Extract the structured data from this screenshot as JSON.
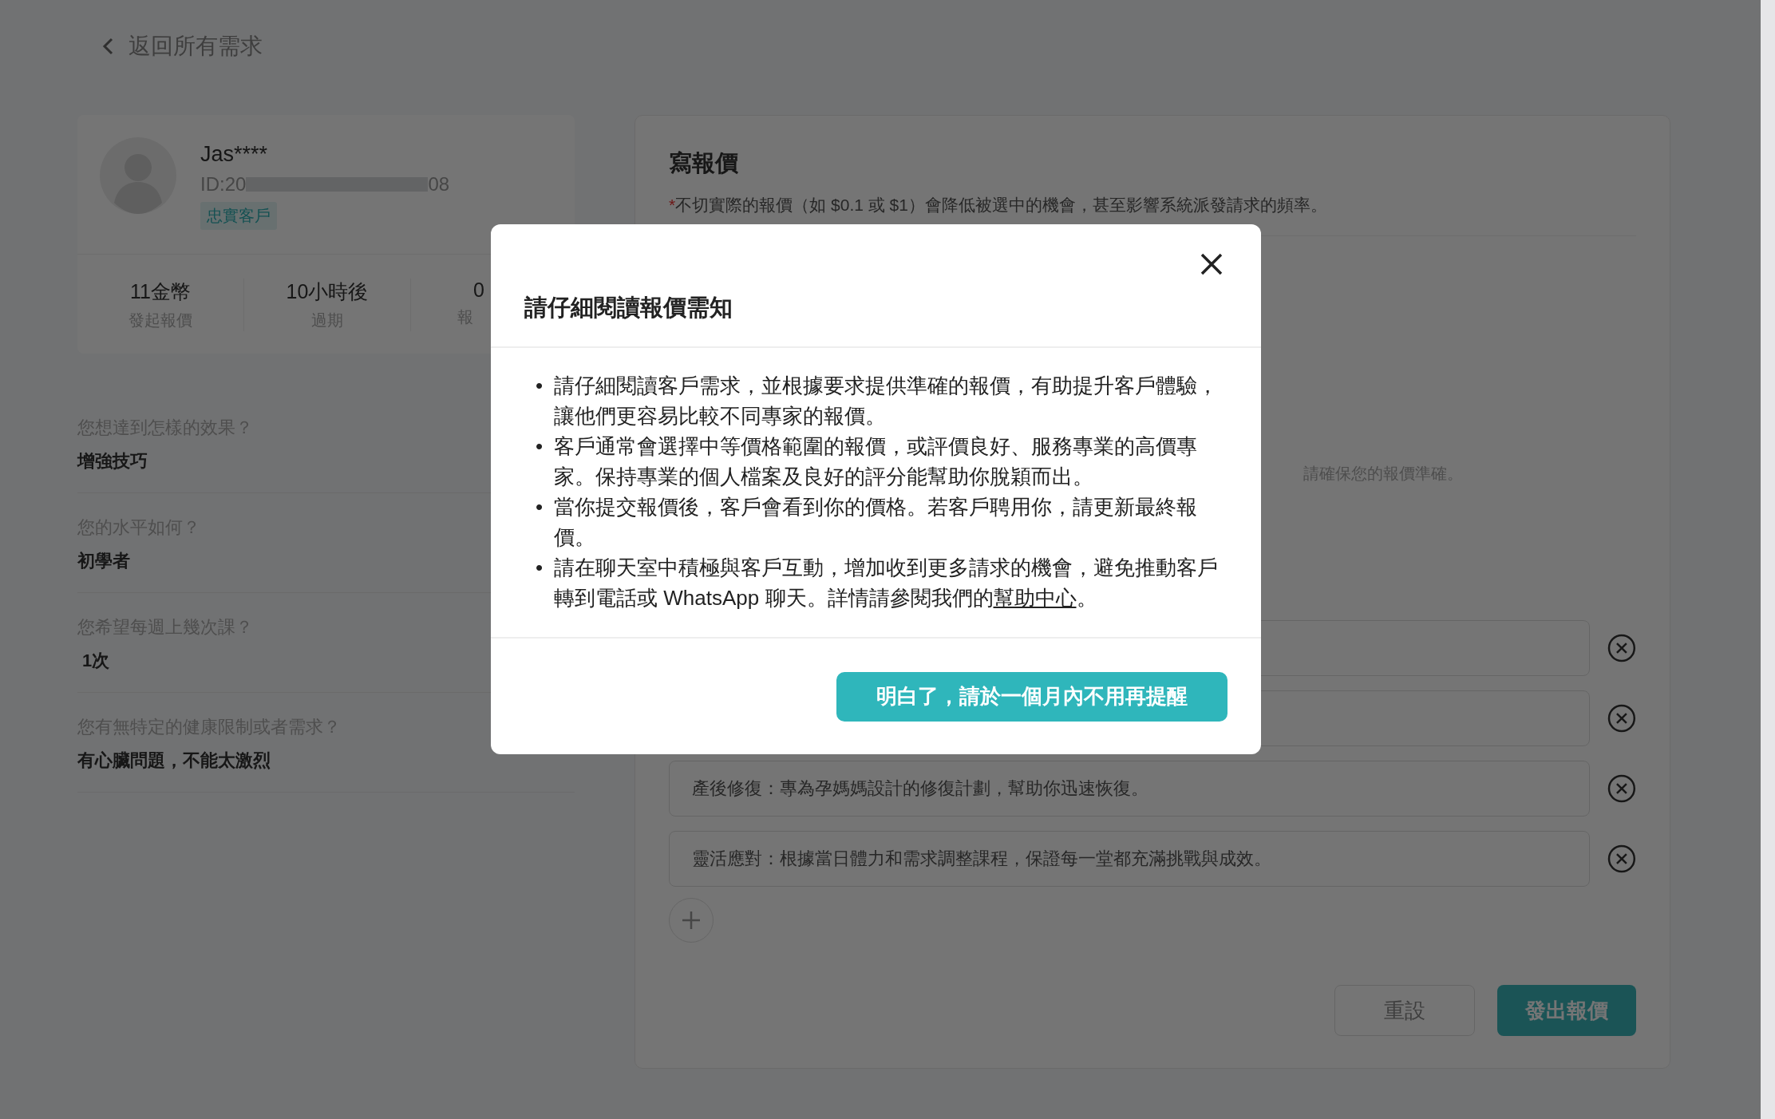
{
  "back_link": {
    "label": "返回所有需求"
  },
  "profile": {
    "name": "Jas****",
    "id_start": "ID:20",
    "id_end": "08",
    "badge": "忠實客戶",
    "stats": [
      {
        "value": "11金幣",
        "label": "發起報價"
      },
      {
        "value": "10小時後",
        "label": "過期"
      },
      {
        "value": "0",
        "label": "報"
      }
    ]
  },
  "questions": [
    {
      "question": "您想達到怎樣的效果？",
      "answer": "增強技巧"
    },
    {
      "question": "您的水平如何？",
      "answer": "初學者"
    },
    {
      "question": "您希望每週上幾次課？",
      "answer": "1次"
    },
    {
      "question": "您有無特定的健康限制或者需求？",
      "answer": "有心臟問題，不能太激烈"
    }
  ],
  "quote_panel": {
    "title": "寫報價",
    "note_mark": "*",
    "note": "不切實際的報價（如 $0.1 或 $1）會降低被選中的機會，甚至影響系統派發請求的頻率。",
    "hint": "請確保您的報價準確。",
    "items": [
      {
        "kind": "covered"
      },
      {
        "kind": "covered"
      },
      {
        "kind": "text",
        "value": "產後修復：專為孕媽媽設計的修復計劃，幫助你迅速恢復。"
      },
      {
        "kind": "text",
        "value": "靈活應對：根據當日體力和需求調整課程，保證每一堂都充滿挑戰與成效。"
      }
    ],
    "reset_button": "重設",
    "submit_button": "發出報價"
  },
  "modal": {
    "title": "請仔細閱讀報價需知",
    "bullet": "•",
    "bullets": [
      {
        "text": "請仔細閱讀客戶需求，並根據要求提供準確的報價，有助提升客戶體驗，讓他們更容易比較不同專家的報價。"
      },
      {
        "text": "客戶通常會選擇中等價格範圍的報價，或評價良好、服務專業的高價專家。保持專業的個人檔案及良好的評分能幫助你脫穎而出。"
      },
      {
        "text": "當你提交報價後，客戶會看到你的價格。若客戶聘用你，請更新最終報價。"
      },
      {
        "text": "請在聊天室中積極與客戶互動，增加收到更多請求的機會，避免推動客戶轉到電話或 WhatsApp 聊天。詳情請參閱我們的",
        "link": "幫助中心",
        "after": "。"
      }
    ],
    "confirm_button": "明白了，請於一個月內不用再提醒"
  }
}
